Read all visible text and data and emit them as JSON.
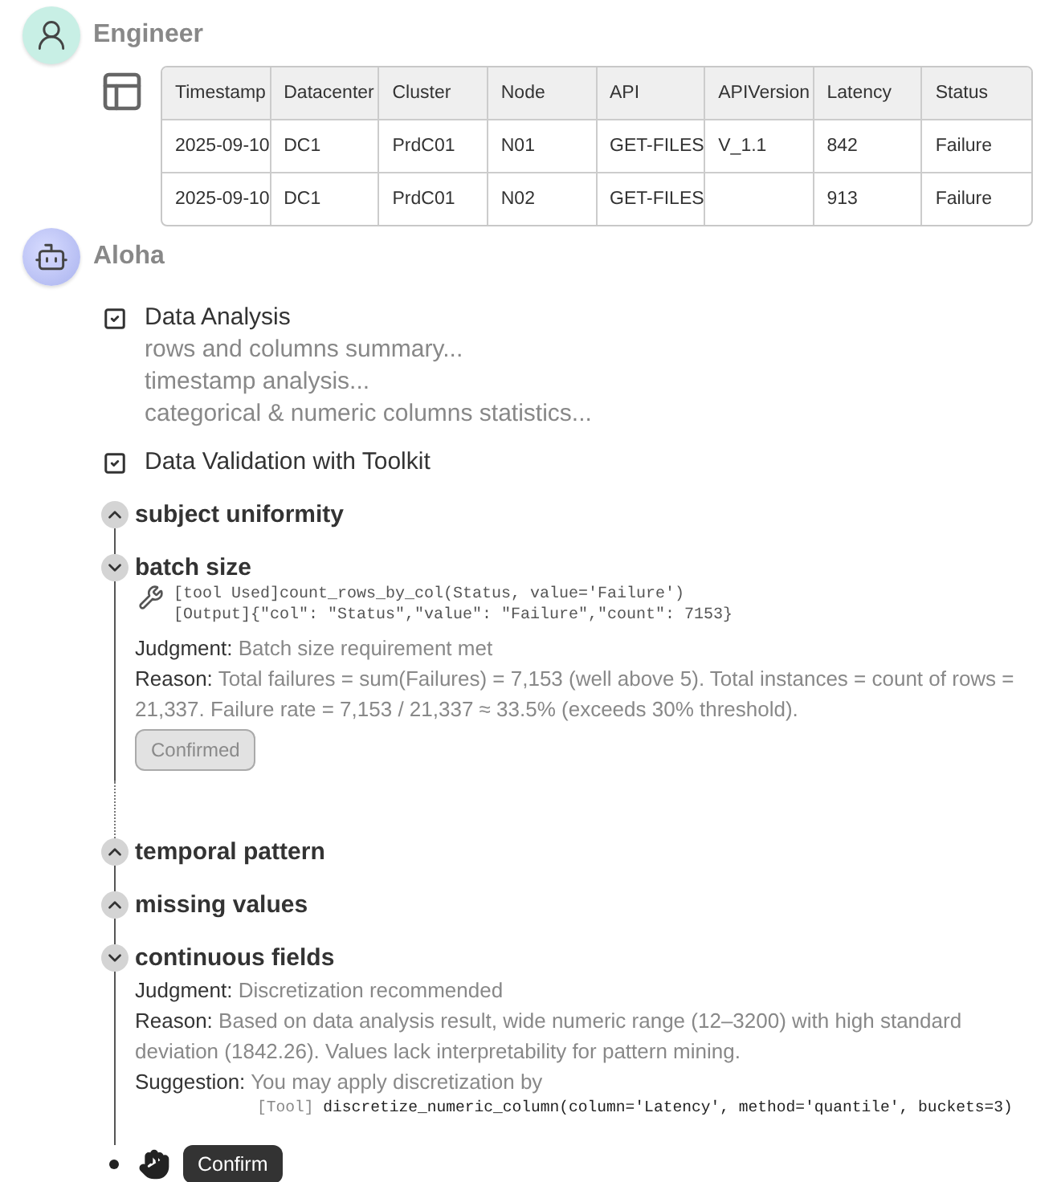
{
  "engineer": {
    "name": "Engineer",
    "table": {
      "columns": [
        "Timestamp",
        "Datacenter",
        "Cluster",
        "Node",
        "API",
        "APIVersion",
        "Latency",
        "Status"
      ],
      "rows": [
        [
          "2025-09-10",
          "DC1",
          "PrdC01",
          "N01",
          "GET-FILES",
          "V_1.1",
          "842",
          "Failure"
        ],
        [
          "2025-09-10",
          "DC1",
          "PrdC01",
          "N02",
          "GET-FILES",
          null,
          "913",
          "Failure"
        ]
      ]
    }
  },
  "assistant": {
    "name": "Aloha",
    "checklist": [
      {
        "title": "Data Analysis",
        "checked": true,
        "details": [
          "rows and columns summary...",
          "timestamp analysis...",
          "categorical & numeric columns statistics..."
        ]
      },
      {
        "title": "Data Validation with Toolkit",
        "checked": true
      }
    ],
    "steps": [
      {
        "title": "subject uniformity",
        "expanded": false,
        "gap_after": false
      },
      {
        "title": "batch size",
        "expanded": true,
        "gap_after": true,
        "tool_log": [
          "[tool Used]count_rows_by_col(Status, value='Failure')",
          "[Output]{\"col\": \"Status\",\"value\": \"Failure\",\"count\": 7153}"
        ],
        "notes": [
          {
            "label": "Judgment:",
            "text": "Batch size requirement met"
          },
          {
            "label": "Reason:",
            "text": "Total failures = sum(Failures) = 7,153 (well above 5). Total instances = count of rows = 21,337. Failure rate = 7,153 / 21,337 ≈ 33.5% (exceeds 30% threshold)."
          }
        ],
        "button": {
          "label": "Confirmed",
          "disabled": true
        }
      },
      {
        "title": "temporal pattern",
        "expanded": false,
        "gap_after": false
      },
      {
        "title": "missing values",
        "expanded": false,
        "gap_after": false
      },
      {
        "title": "continuous fields",
        "expanded": true,
        "gap_after": false,
        "notes": [
          {
            "label": "Judgment:",
            "text": "Discretization recommended"
          },
          {
            "label": "Reason:",
            "text": "Based on data analysis result, wide numeric range (12–3200) with high standard deviation (1842.26). Values lack interpretability for pattern mining."
          },
          {
            "label": "Suggestion:",
            "text": "You may apply discretization by"
          }
        ],
        "tool_call": {
          "tag": "[Tool]",
          "code": "discretize_numeric_column(column='Latency', method='quantile', buckets=3)"
        }
      }
    ],
    "action": {
      "label": "Confirm"
    }
  }
}
